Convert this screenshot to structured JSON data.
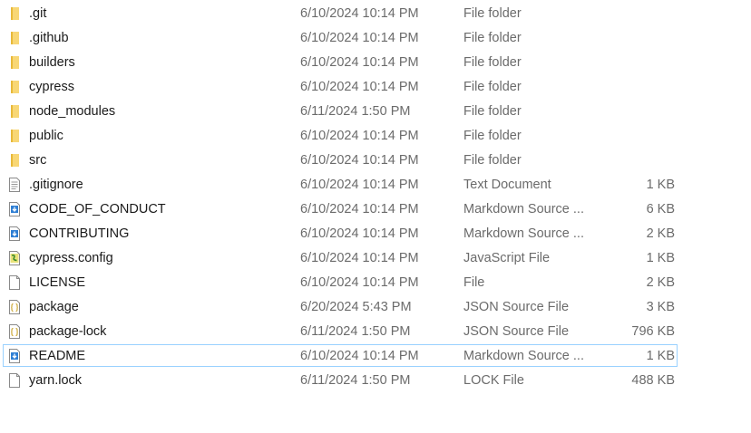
{
  "colors": {
    "folder": "#f8d775",
    "folder_shade": "#e8b93a",
    "selection_border": "#99d1ff",
    "secondary_text": "#6b6b6b"
  },
  "files": [
    {
      "name": ".git",
      "date": "6/10/2024 10:14 PM",
      "type": "File folder",
      "size": "",
      "icon": "folder-icon"
    },
    {
      "name": ".github",
      "date": "6/10/2024 10:14 PM",
      "type": "File folder",
      "size": "",
      "icon": "folder-icon"
    },
    {
      "name": "builders",
      "date": "6/10/2024 10:14 PM",
      "type": "File folder",
      "size": "",
      "icon": "folder-icon"
    },
    {
      "name": "cypress",
      "date": "6/10/2024 10:14 PM",
      "type": "File folder",
      "size": "",
      "icon": "folder-icon"
    },
    {
      "name": "node_modules",
      "date": "6/11/2024 1:50 PM",
      "type": "File folder",
      "size": "",
      "icon": "folder-icon"
    },
    {
      "name": "public",
      "date": "6/10/2024 10:14 PM",
      "type": "File folder",
      "size": "",
      "icon": "folder-icon"
    },
    {
      "name": "src",
      "date": "6/10/2024 10:14 PM",
      "type": "File folder",
      "size": "",
      "icon": "folder-icon"
    },
    {
      "name": ".gitignore",
      "date": "6/10/2024 10:14 PM",
      "type": "Text Document",
      "size": "1 KB",
      "icon": "text-document-icon"
    },
    {
      "name": "CODE_OF_CONDUCT",
      "date": "6/10/2024 10:14 PM",
      "type": "Markdown Source ...",
      "size": "6 KB",
      "icon": "markdown-file-icon"
    },
    {
      "name": "CONTRIBUTING",
      "date": "6/10/2024 10:14 PM",
      "type": "Markdown Source ...",
      "size": "2 KB",
      "icon": "markdown-file-icon"
    },
    {
      "name": "cypress.config",
      "date": "6/10/2024 10:14 PM",
      "type": "JavaScript File",
      "size": "1 KB",
      "icon": "javascript-file-icon"
    },
    {
      "name": "LICENSE",
      "date": "6/10/2024 10:14 PM",
      "type": "File",
      "size": "2 KB",
      "icon": "blank-file-icon"
    },
    {
      "name": "package",
      "date": "6/20/2024 5:43 PM",
      "type": "JSON Source File",
      "size": "3 KB",
      "icon": "json-file-icon"
    },
    {
      "name": "package-lock",
      "date": "6/11/2024 1:50 PM",
      "type": "JSON Source File",
      "size": "796 KB",
      "icon": "json-file-icon"
    },
    {
      "name": "README",
      "date": "6/10/2024 10:14 PM",
      "type": "Markdown Source ...",
      "size": "1 KB",
      "icon": "markdown-file-icon",
      "selected": true
    },
    {
      "name": "yarn.lock",
      "date": "6/11/2024 1:50 PM",
      "type": "LOCK File",
      "size": "488 KB",
      "icon": "blank-file-icon"
    }
  ]
}
